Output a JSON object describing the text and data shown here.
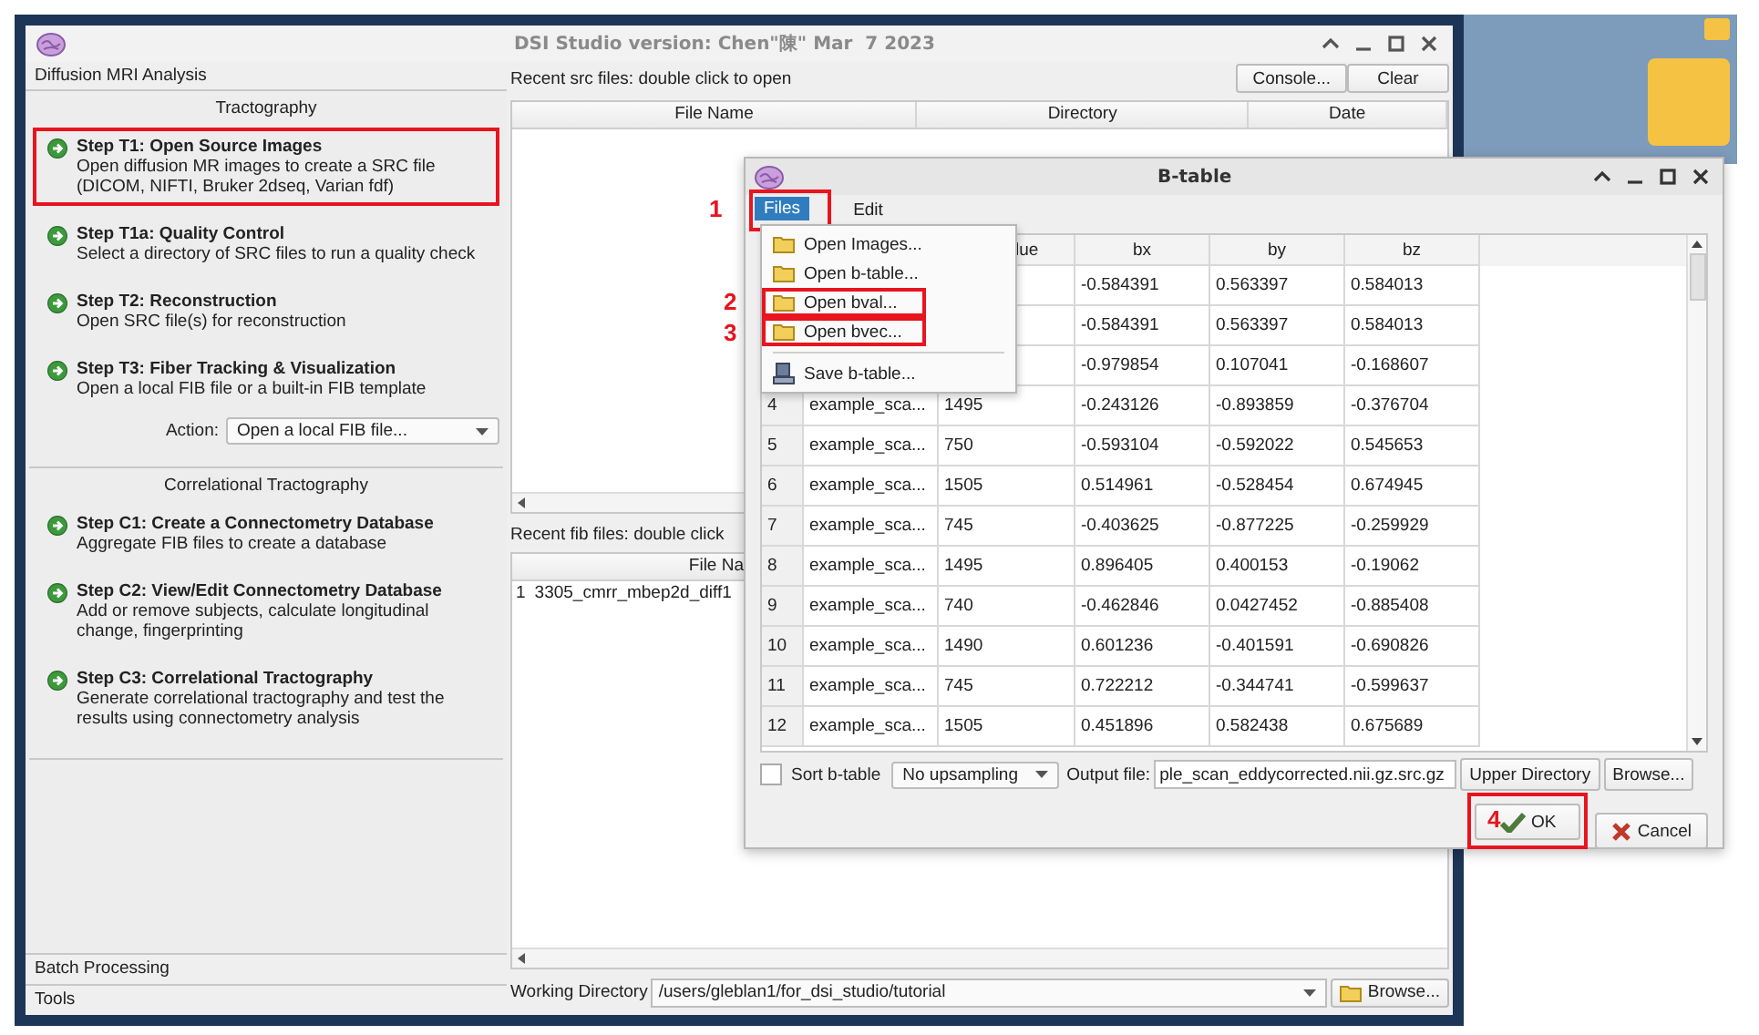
{
  "window": {
    "title": "DSI Studio version: Chen\"陳\" Mar  7 2023"
  },
  "left_panel": {
    "tab": "Diffusion MRI Analysis",
    "sections": [
      {
        "title": "Tractography",
        "steps": [
          {
            "title": "Step T1: Open Source Images",
            "description": "Open diffusion MR images to create a SRC file (DICOM, NIFTI, Bruker 2dseq, Varian fdf)",
            "highlighted": true
          },
          {
            "title": "Step T1a: Quality Control",
            "description": "Select a directory of SRC files to run a quality check",
            "highlighted": false
          },
          {
            "title": "Step T2: Reconstruction",
            "description": "Open SRC file(s) for reconstruction",
            "highlighted": false
          },
          {
            "title": "Step T3: Fiber Tracking & Visualization",
            "description": "Open a local FIB file or a built-in FIB template",
            "highlighted": false
          }
        ],
        "action": {
          "label": "Action:",
          "value": "Open a local FIB file..."
        }
      },
      {
        "title": "Correlational Tractography",
        "steps": [
          {
            "title": "Step C1: Create a Connectometry Database",
            "description": "Aggregate FIB files to create a database",
            "highlighted": false
          },
          {
            "title": "Step C2: View/Edit Connectometry Database",
            "description": "Add or remove subjects, calculate longitudinal change, fingerprinting",
            "highlighted": false
          },
          {
            "title": "Step C3: Correlational Tractography",
            "description": "Generate correlational tractography and test the results using connectometry analysis",
            "highlighted": false
          }
        ]
      }
    ],
    "bottom_tabs": [
      "Batch Processing",
      "Tools"
    ]
  },
  "src_files": {
    "label": "Recent src files: double click to open",
    "buttons": [
      "Console...",
      "Clear"
    ],
    "columns": [
      "File Name",
      "Directory",
      "Date"
    ]
  },
  "fib_files": {
    "label": "Recent fib files: double click",
    "column": "File Na",
    "rows": [
      {
        "index": "1",
        "file_name": "3305_cmrr_mbep2d_diff1"
      }
    ]
  },
  "working_directory": {
    "label": "Working Directory",
    "value": "/users/gleblan1/for_dsi_studio/tutorial",
    "button": "Browse..."
  },
  "dialog": {
    "title": "B-table",
    "menus": [
      {
        "label": "Files",
        "selected": true,
        "highlighted": true
      },
      {
        "label": "Edit",
        "selected": false,
        "highlighted": false
      }
    ],
    "files_menu": [
      {
        "kind": "folder",
        "label": "Open Images...",
        "highlighted": false
      },
      {
        "kind": "folder",
        "label": "Open b-table...",
        "highlighted": false
      },
      {
        "kind": "folder",
        "label": "Open bval...",
        "highlighted": true
      },
      {
        "kind": "folder",
        "label": "Open bvec...",
        "highlighted": true
      },
      {
        "kind": "separator"
      },
      {
        "kind": "save",
        "label": "Save b-table...",
        "highlighted": false
      }
    ],
    "table": {
      "columns": [
        "lue",
        "bx",
        "by",
        "bz"
      ],
      "rows": [
        {
          "bx": "-0.584391",
          "by": "0.563397",
          "bz": "0.584013"
        },
        {
          "bx": "-0.584391",
          "by": "0.563397",
          "bz": "0.584013"
        },
        {
          "bx": "-0.979854",
          "by": "0.107041",
          "bz": "-0.168607"
        },
        {
          "index": "4",
          "name": "example_sca...",
          "b_value": "1495",
          "bx": "-0.243126",
          "by": "-0.893859",
          "bz": "-0.376704"
        },
        {
          "index": "5",
          "name": "example_sca...",
          "b_value": "750",
          "bx": "-0.593104",
          "by": "-0.592022",
          "bz": "0.545653"
        },
        {
          "index": "6",
          "name": "example_sca...",
          "b_value": "1505",
          "bx": "0.514961",
          "by": "-0.528454",
          "bz": "0.674945"
        },
        {
          "index": "7",
          "name": "example_sca...",
          "b_value": "745",
          "bx": "-0.403625",
          "by": "-0.877225",
          "bz": "-0.259929"
        },
        {
          "index": "8",
          "name": "example_sca...",
          "b_value": "1495",
          "bx": "0.896405",
          "by": "0.400153",
          "bz": "-0.19062"
        },
        {
          "index": "9",
          "name": "example_sca...",
          "b_value": "740",
          "bx": "-0.462846",
          "by": "0.0427452",
          "bz": "-0.885408"
        },
        {
          "index": "10",
          "name": "example_sca...",
          "b_value": "1490",
          "bx": "0.601236",
          "by": "-0.401591",
          "bz": "-0.690826"
        },
        {
          "index": "11",
          "name": "example_sca...",
          "b_value": "745",
          "bx": "0.722212",
          "by": "-0.344741",
          "bz": "-0.599637"
        },
        {
          "index": "12",
          "name": "example_sca...",
          "b_value": "1505",
          "bx": "0.451896",
          "by": "0.582438",
          "bz": "0.675689"
        }
      ]
    },
    "sort": {
      "label": "Sort b-table",
      "checked": false
    },
    "upsampling": "No upsampling",
    "output": {
      "label": "Output file:",
      "value": "ple_scan_eddycorrected.nii.gz.src.gz"
    },
    "buttons": [
      "Upper Directory",
      "Browse..."
    ],
    "ok": {
      "label": "OK",
      "highlighted": true
    },
    "cancel": "Cancel"
  },
  "annotations": [
    {
      "number": "1"
    },
    {
      "number": "2"
    },
    {
      "number": "3"
    },
    {
      "number": "4"
    }
  ]
}
